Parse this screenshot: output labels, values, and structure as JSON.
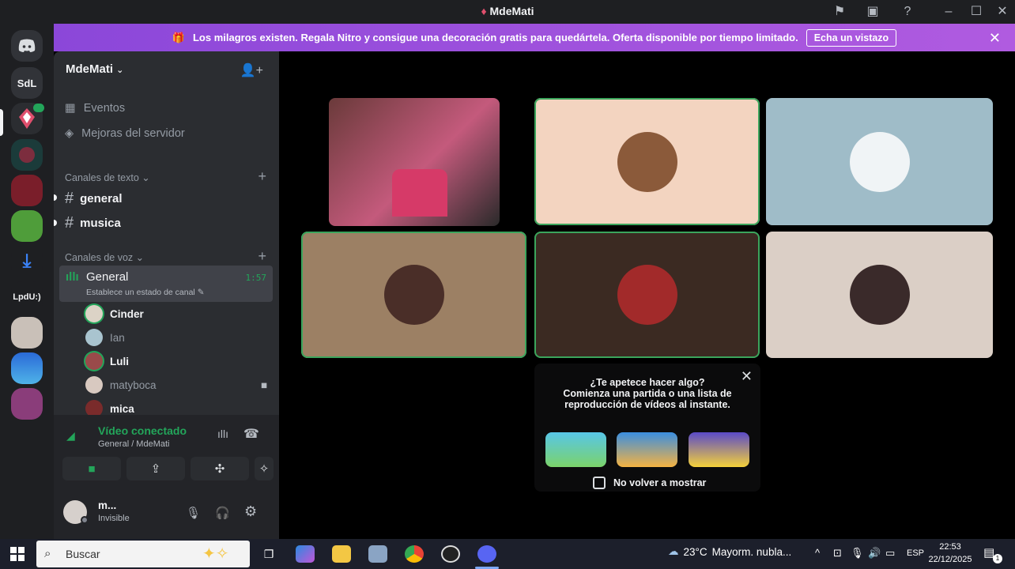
{
  "window": {
    "title": "MdeMati"
  },
  "banner": {
    "text": "Los milagros existen. Regala Nitro y consigue una decoración gratis para quedártela. Oferta disponible por tiempo limitado.",
    "cta": "Echa un vistazo"
  },
  "servers": [
    {
      "label": "SdL"
    },
    {
      "label": "LpdU:)"
    }
  ],
  "guild": {
    "name": "MdeMati"
  },
  "nav": {
    "events": "Eventos",
    "boosts": "Mejoras del servidor"
  },
  "categories": {
    "text": "Canales de texto",
    "voice": "Canales de voz"
  },
  "text_channels": [
    {
      "name": "general"
    },
    {
      "name": "musica"
    }
  ],
  "voice_channel": {
    "name": "General",
    "timer": "1:57",
    "status": "Establece un estado de canal"
  },
  "members": [
    {
      "name": "Cinder"
    },
    {
      "name": "Ian"
    },
    {
      "name": "Luli"
    },
    {
      "name": "matyboca"
    },
    {
      "name": "mica"
    }
  ],
  "connection": {
    "title": "Vídeo conectado",
    "subtitle": "General / MdeMati"
  },
  "user": {
    "name": "m...",
    "status": "Invisible"
  },
  "activity": {
    "heading": "¿Te apetece hacer algo?",
    "body_line1": "Comienza una partida o una lista de",
    "body_line2": "reproducción de vídeos al instante.",
    "checkbox": "No volver a mostrar"
  },
  "taskbar": {
    "search_placeholder": "Buscar",
    "weather_temp": "23°C",
    "weather_text": "Mayorm. nubla...",
    "language": "ESP",
    "time": "22:53",
    "date": "22/12/2025",
    "notif_count": "1"
  },
  "colors": {
    "speaking": "#3ba55c",
    "connected": "#23a55a",
    "banner_from": "#8b47d9",
    "banner_to": "#b05be0"
  }
}
